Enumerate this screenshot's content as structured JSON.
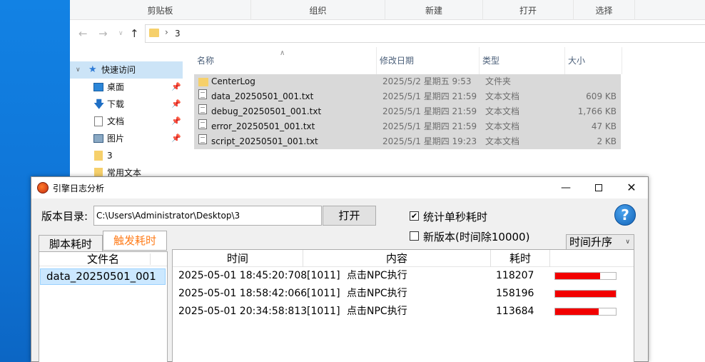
{
  "explorer": {
    "ribbon": [
      "剪贴板",
      "组织",
      "新建",
      "打开",
      "选择"
    ],
    "address": {
      "path": "3"
    },
    "nav": {
      "quick_access": "快速访问",
      "items": [
        {
          "label": "桌面",
          "icon": "desktop-icon",
          "pinned": true
        },
        {
          "label": "下载",
          "icon": "download-icon",
          "pinned": true
        },
        {
          "label": "文档",
          "icon": "document-icon",
          "pinned": true
        },
        {
          "label": "图片",
          "icon": "picture-icon",
          "pinned": true
        },
        {
          "label": "3",
          "icon": "folder-icon",
          "pinned": false
        },
        {
          "label": "常用文本",
          "icon": "folder-icon",
          "pinned": false
        }
      ]
    },
    "columns": {
      "name": "名称",
      "date": "修改日期",
      "type": "类型",
      "size": "大小"
    },
    "files": [
      {
        "name": "CenterLog",
        "date": "2025/5/2 星期五 9:53",
        "type": "文件夹",
        "size": "",
        "kind": "folder"
      },
      {
        "name": "data_20250501_001.txt",
        "date": "2025/5/1 星期四 21:59",
        "type": "文本文档",
        "size": "609 KB",
        "kind": "txt"
      },
      {
        "name": "debug_20250501_001.txt",
        "date": "2025/5/1 星期四 21:59",
        "type": "文本文档",
        "size": "1,766 KB",
        "kind": "txt"
      },
      {
        "name": "error_20250501_001.txt",
        "date": "2025/5/1 星期四 21:59",
        "type": "文本文档",
        "size": "47 KB",
        "kind": "txt"
      },
      {
        "name": "script_20250501_001.txt",
        "date": "2025/5/1 星期四 19:23",
        "type": "文本文档",
        "size": "2 KB",
        "kind": "txt"
      }
    ]
  },
  "dialog": {
    "title": "引擎日志分析",
    "dir_label": "版本目录:",
    "dir_value": "C:\\Users\\Administrator\\Desktop\\3",
    "open_button": "打开",
    "checkbox_per_second": {
      "label": "统计单秒耗时",
      "checked": true
    },
    "checkbox_new_version": {
      "label": "新版本(时间除10000)",
      "checked": false
    },
    "help": "?",
    "sort_select": "时间升序",
    "tabs": [
      {
        "label": "脚本耗时",
        "active": false
      },
      {
        "label": "触发耗时",
        "active": true
      }
    ],
    "active_tab_color": "#ff7c1a",
    "file_list": {
      "header": "文件名",
      "items": [
        "data_20250501_001"
      ]
    },
    "log_table": {
      "headers": {
        "time": "时间",
        "content": "内容",
        "cost": "耗时"
      },
      "bar_color": "#f20000",
      "rows": [
        {
          "time": "2025-05-01 18:45:20:708",
          "id": "[1011]",
          "content": "点击NPC执行",
          "cost": "118207",
          "ratio": 0.747
        },
        {
          "time": "2025-05-01 18:58:42:066",
          "id": "[1011]",
          "content": "点击NPC执行",
          "cost": "158196",
          "ratio": 1.0
        },
        {
          "time": "2025-05-01 20:34:58:813",
          "id": "[1011]",
          "content": "点击NPC执行",
          "cost": "113684",
          "ratio": 0.719
        }
      ]
    }
  }
}
